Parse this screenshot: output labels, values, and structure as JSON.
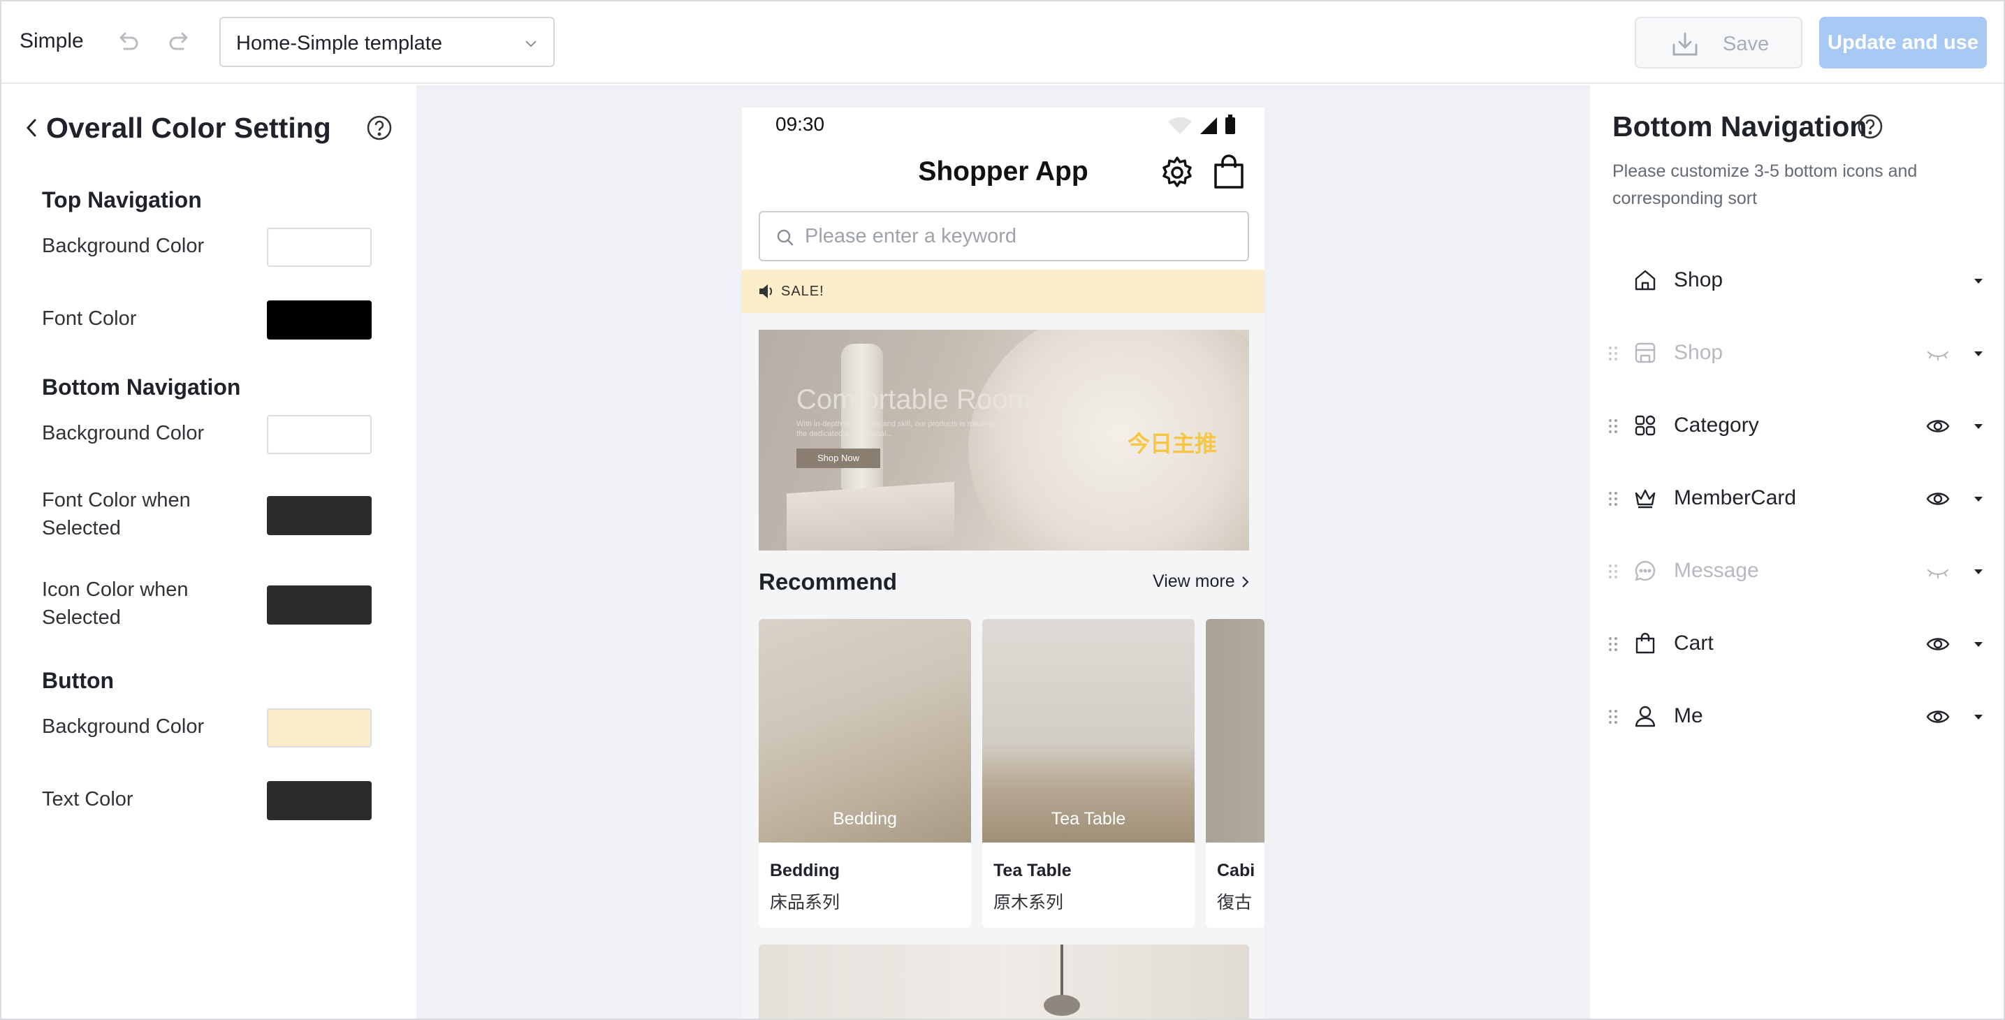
{
  "topbar": {
    "app_name": "Simple",
    "template_select": "Home-Simple template",
    "save_label": "Save",
    "update_label": "Update and use"
  },
  "left_panel": {
    "title": "Overall Color Setting",
    "sections": [
      {
        "heading": "Top Navigation",
        "rows": [
          {
            "label": "Background Color",
            "color": "#ffffff"
          },
          {
            "label": "Font Color",
            "color": "#000000"
          }
        ]
      },
      {
        "heading": "Bottom Navigation",
        "rows": [
          {
            "label": "Background Color",
            "color": "#ffffff"
          },
          {
            "label": "Font Color when Selected",
            "color": "#2b2b2b"
          },
          {
            "label": "Icon Color when Selected",
            "color": "#2b2b2b"
          }
        ]
      },
      {
        "heading": "Button",
        "rows": [
          {
            "label": "Background Color",
            "color": "#fdeecb"
          },
          {
            "label": "Text Color",
            "color": "#2b2b2b"
          }
        ]
      }
    ]
  },
  "phone": {
    "time": "09:30",
    "app_title": "Shopper App",
    "search_placeholder": "Please enter a keyword",
    "sale_text": "SALE!",
    "banner": {
      "title": "Comfortable Room",
      "subtitle": "With in-depth knowledge and skill, our products is made by the dedicated professional...",
      "button": "Shop Now",
      "chinese_tag": "今日主推"
    },
    "recommend_title": "Recommend",
    "view_more": "View more",
    "cards": [
      {
        "overlay": "Bedding",
        "name": "Bedding",
        "sub": "床品系列"
      },
      {
        "overlay": "Tea Table",
        "name": "Tea Table",
        "sub": "原木系列"
      },
      {
        "overlay": "",
        "name": "Cabi",
        "sub": "復古"
      }
    ]
  },
  "right_panel": {
    "title": "Bottom Navigation",
    "description": "Please customize 3-5 bottom icons and corresponding sort",
    "items": [
      {
        "label": "Shop",
        "icon": "home-icon",
        "visible": true,
        "draggable": false
      },
      {
        "label": "Shop",
        "icon": "store-icon",
        "visible": false,
        "draggable": true
      },
      {
        "label": "Category",
        "icon": "grid-icon",
        "visible": true,
        "draggable": true
      },
      {
        "label": "MemberCard",
        "icon": "crown-icon",
        "visible": true,
        "draggable": true
      },
      {
        "label": "Message",
        "icon": "chat-icon",
        "visible": false,
        "draggable": true
      },
      {
        "label": "Cart",
        "icon": "bag-icon",
        "visible": true,
        "draggable": true
      },
      {
        "label": "Me",
        "icon": "user-icon",
        "visible": true,
        "draggable": true
      }
    ]
  },
  "colors": {
    "primary_disabled": "#a8c9f4",
    "canvas_bg": "#eff1f4",
    "sale_bg": "#fdeecb"
  }
}
